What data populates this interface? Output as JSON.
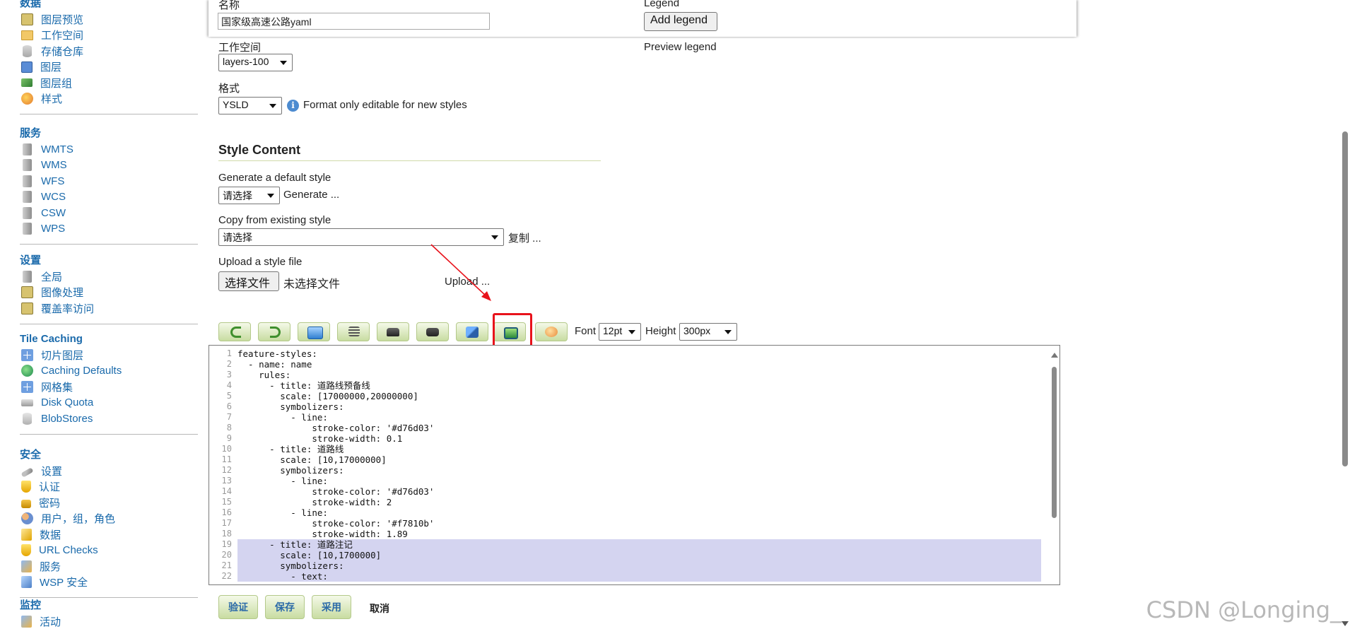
{
  "sidebar": {
    "sections": [
      {
        "heading": "数据",
        "items": [
          {
            "label": "图层预览",
            "icon": "layer-preview-icon"
          },
          {
            "label": "工作空间",
            "icon": "folder-icon"
          },
          {
            "label": "存储仓库",
            "icon": "database-icon"
          },
          {
            "label": "图层",
            "icon": "layer-icon"
          },
          {
            "label": "图层组",
            "icon": "layer-group-icon"
          },
          {
            "label": "样式",
            "icon": "style-icon"
          }
        ]
      },
      {
        "heading": "服务",
        "items": [
          {
            "label": "WMTS",
            "icon": "server-icon"
          },
          {
            "label": "WMS",
            "icon": "server-icon"
          },
          {
            "label": "WFS",
            "icon": "server-icon"
          },
          {
            "label": "WCS",
            "icon": "server-icon"
          },
          {
            "label": "CSW",
            "icon": "server-icon"
          },
          {
            "label": "WPS",
            "icon": "server-icon"
          }
        ]
      },
      {
        "heading": "设置",
        "items": [
          {
            "label": "全局",
            "icon": "server-icon"
          },
          {
            "label": "图像处理",
            "icon": "image-processing-icon"
          },
          {
            "label": "覆盖率访问",
            "icon": "coverage-access-icon"
          }
        ]
      },
      {
        "heading": "Tile Caching",
        "items": [
          {
            "label": "切片图层",
            "icon": "tile-layer-icon"
          },
          {
            "label": "Caching Defaults",
            "icon": "globe-icon"
          },
          {
            "label": "网格集",
            "icon": "gridset-icon"
          },
          {
            "label": "Disk Quota",
            "icon": "disk-icon"
          },
          {
            "label": "BlobStores",
            "icon": "blobstore-icon"
          }
        ]
      },
      {
        "heading": "安全",
        "items": [
          {
            "label": "设置",
            "icon": "key-icon"
          },
          {
            "label": "认证",
            "icon": "shield-icon"
          },
          {
            "label": "密码",
            "icon": "lock-icon"
          },
          {
            "label": "用户，组，角色",
            "icon": "users-icon"
          },
          {
            "label": "数据",
            "icon": "data-security-icon"
          },
          {
            "label": "URL Checks",
            "icon": "shield-icon"
          },
          {
            "label": "服务",
            "icon": "service-security-icon"
          },
          {
            "label": "WSP 安全",
            "icon": "wsp-icon"
          }
        ]
      },
      {
        "heading": "监控",
        "items": [
          {
            "label": "活动",
            "icon": "activity-icon"
          }
        ]
      }
    ]
  },
  "form": {
    "name_label": "名称",
    "name_value": "国家级高速公路yaml",
    "workspace_label": "工作空间",
    "workspace_value": "layers-100",
    "format_label": "格式",
    "format_value": "YSLD",
    "format_note": "Format only editable for new styles",
    "legend_label": "Legend",
    "add_legend_button": "Add legend",
    "preview_legend_link": "Preview legend"
  },
  "style_content": {
    "title": "Style Content",
    "generate_label": "Generate a default style",
    "generate_select": "请选择",
    "generate_link": "Generate ...",
    "copy_label": "Copy from existing style",
    "copy_select": "请选择",
    "copy_link": "复制 ...",
    "upload_label": "Upload a style file",
    "choose_file_button": "选择文件",
    "no_file_text": "未选择文件",
    "upload_link": "Upload ..."
  },
  "toolbar": {
    "font_label": "Font",
    "font_value": "12pt",
    "height_label": "Height",
    "height_value": "300px",
    "highlighted_button": "legend-preview"
  },
  "editor": {
    "lines": [
      {
        "n": "1",
        "text": "feature-styles:"
      },
      {
        "n": "2",
        "text": "  - name: name"
      },
      {
        "n": "3",
        "text": "    rules:"
      },
      {
        "n": "4",
        "text": "      - title: 道路线预备线"
      },
      {
        "n": "5",
        "text": "        scale: [17000000,20000000]"
      },
      {
        "n": "6",
        "text": "        symbolizers:"
      },
      {
        "n": "7",
        "text": "          - line:"
      },
      {
        "n": "8",
        "text": "              stroke-color: '#d76d03'"
      },
      {
        "n": "9",
        "text": "              stroke-width: 0.1"
      },
      {
        "n": "10",
        "text": "      - title: 道路线"
      },
      {
        "n": "11",
        "text": "        scale: [10,17000000]"
      },
      {
        "n": "12",
        "text": "        symbolizers:"
      },
      {
        "n": "13",
        "text": "          - line:"
      },
      {
        "n": "14",
        "text": "              stroke-color: '#d76d03'"
      },
      {
        "n": "15",
        "text": "              stroke-width: 2"
      },
      {
        "n": "16",
        "text": "          - line:"
      },
      {
        "n": "17",
        "text": "              stroke-color: '#f7810b'"
      },
      {
        "n": "18",
        "text": "              stroke-width: 1.89"
      },
      {
        "n": "19",
        "text": "      - title: 道路注记",
        "selected": true
      },
      {
        "n": "20",
        "text": "        scale: [10,1700000]",
        "selected": true
      },
      {
        "n": "21",
        "text": "        symbolizers:",
        "selected": true
      },
      {
        "n": "22",
        "text": "          - text:",
        "selected": true
      }
    ]
  },
  "actions": {
    "validate": "验证",
    "save": "保存",
    "apply": "采用",
    "cancel": "取消"
  },
  "watermark": "CSDN @Longing_",
  "colors": {
    "link": "#1a6aab",
    "highlight_box": "#e8121b",
    "selection": "#d4d4f0"
  }
}
